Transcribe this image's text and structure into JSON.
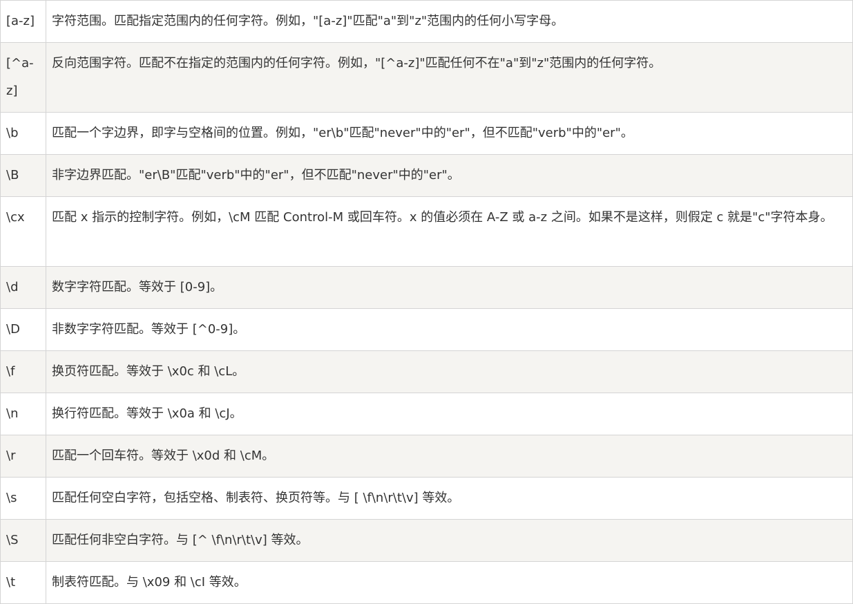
{
  "rows": [
    {
      "pattern": "[a-z]",
      "description": "字符范围。匹配指定范围内的任何字符。例如，\"[a-z]\"匹配\"a\"到\"z\"范围内的任何小写字母。"
    },
    {
      "pattern": "[^a-z]",
      "description": "反向范围字符。匹配不在指定的范围内的任何字符。例如，\"[^a-z]\"匹配任何不在\"a\"到\"z\"范围内的任何字符。"
    },
    {
      "pattern": "\\b",
      "description": "匹配一个字边界，即字与空格间的位置。例如，\"er\\b\"匹配\"never\"中的\"er\"，但不匹配\"verb\"中的\"er\"。"
    },
    {
      "pattern": "\\B",
      "description": "非字边界匹配。\"er\\B\"匹配\"verb\"中的\"er\"，但不匹配\"never\"中的\"er\"。"
    },
    {
      "pattern": "\\cx",
      "description": "匹配 x 指示的控制字符。例如，\\cM 匹配 Control-M 或回车符。x 的值必须在 A-Z 或 a-z 之间。如果不是这样，则假定 c 就是\"c\"字符本身。"
    },
    {
      "pattern": "\\d",
      "description": "数字字符匹配。等效于 [0-9]。"
    },
    {
      "pattern": "\\D",
      "description": "非数字字符匹配。等效于 [^0-9]。"
    },
    {
      "pattern": "\\f",
      "description": "换页符匹配。等效于 \\x0c 和 \\cL。"
    },
    {
      "pattern": "\\n",
      "description": "换行符匹配。等效于 \\x0a 和 \\cJ。"
    },
    {
      "pattern": "\\r",
      "description": "匹配一个回车符。等效于 \\x0d 和 \\cM。"
    },
    {
      "pattern": "\\s",
      "description": "匹配任何空白字符，包括空格、制表符、换页符等。与 [ \\f\\n\\r\\t\\v] 等效。"
    },
    {
      "pattern": "\\S",
      "description": "匹配任何非空白字符。与 [^ \\f\\n\\r\\t\\v] 等效。"
    },
    {
      "pattern": "\\t",
      "description": "制表符匹配。与 \\x09 和 \\cI 等效。"
    }
  ]
}
